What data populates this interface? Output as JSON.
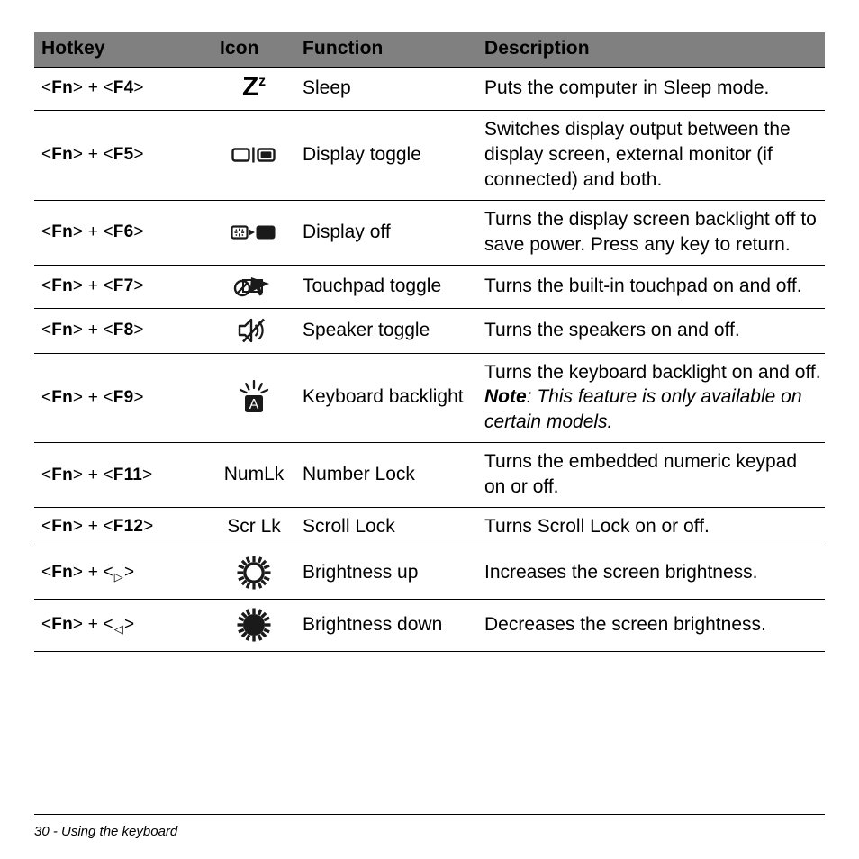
{
  "page": {
    "footer_text": "30 - Using the keyboard",
    "header_bg": "#808080",
    "rule_color": "#000000",
    "text_color": "#000000"
  },
  "table": {
    "columns": [
      "Hotkey",
      "Icon",
      "Function",
      "Description"
    ],
    "rows": [
      {
        "hotkey_prefix": "<",
        "hotkey": "<Fn> + <F4>",
        "hotkey_key1": "Fn",
        "hotkey_key2": "F4",
        "icon_kind": "sleep-z-icon",
        "icon_text": "Z",
        "icon_sup": "z",
        "function": "Sleep",
        "description": "Puts the computer in Sleep mode."
      },
      {
        "hotkey": "<Fn> + <F5>",
        "hotkey_key1": "Fn",
        "hotkey_key2": "F5",
        "icon_kind": "display-toggle-icon",
        "icon_text": "",
        "function": "Display toggle",
        "description": "Switches display output between the display screen, external monitor (if connected) and both."
      },
      {
        "hotkey": "<Fn> + <F6>",
        "hotkey_key1": "Fn",
        "hotkey_key2": "F6",
        "icon_kind": "display-off-icon",
        "icon_text": "",
        "function": "Display off",
        "description": "Turns the display screen backlight off to save power. Press any key to return."
      },
      {
        "hotkey": "<Fn> + <F7>",
        "hotkey_key1": "Fn",
        "hotkey_key2": "F7",
        "icon_kind": "touchpad-off-icon",
        "icon_text": "",
        "function": "Touchpad toggle",
        "description": "Turns the built-in touchpad on and off."
      },
      {
        "hotkey": "<Fn> + <F8>",
        "hotkey_key1": "Fn",
        "hotkey_key2": "F8",
        "icon_kind": "speaker-mute-icon",
        "icon_text": "",
        "function": "Speaker toggle",
        "description": "Turns the speakers on and off."
      },
      {
        "hotkey": "<Fn> + <F9>",
        "hotkey_key1": "Fn",
        "hotkey_key2": "F9",
        "icon_kind": "keyboard-backlight-icon",
        "icon_text": "A",
        "function": "Keyboard backlight",
        "description": "Turns the keyboard backlight on and off.",
        "note_label": "Note",
        "note_body": ": This feature is only available on certain models."
      },
      {
        "hotkey": "<Fn> + <F11>",
        "hotkey_key1": "Fn",
        "hotkey_key2": "F11",
        "icon_kind": "numlk-text-icon",
        "icon_text": "NumLk",
        "function": "Number Lock",
        "description": "Turns the embedded numeric keypad on or off."
      },
      {
        "hotkey": "<Fn> + <F12>",
        "hotkey_key1": "Fn",
        "hotkey_key2": "F12",
        "icon_kind": "scrlk-text-icon",
        "icon_text": "Scr Lk",
        "function": "Scroll Lock",
        "description": "Turns Scroll Lock on or off."
      },
      {
        "hotkey": "<Fn> + < ▷ >",
        "hotkey_key1": "Fn",
        "hotkey_key2": "▷",
        "icon_kind": "brightness-up-icon",
        "icon_text": "",
        "function": "Brightness up",
        "description": "Increases the screen brightness."
      },
      {
        "hotkey": "<Fn> + < ◁ >",
        "hotkey_key1": "Fn",
        "hotkey_key2": "◁",
        "icon_kind": "brightness-down-icon",
        "icon_text": "",
        "function": "Brightness down",
        "description": "Decreases the screen brightness."
      }
    ]
  }
}
